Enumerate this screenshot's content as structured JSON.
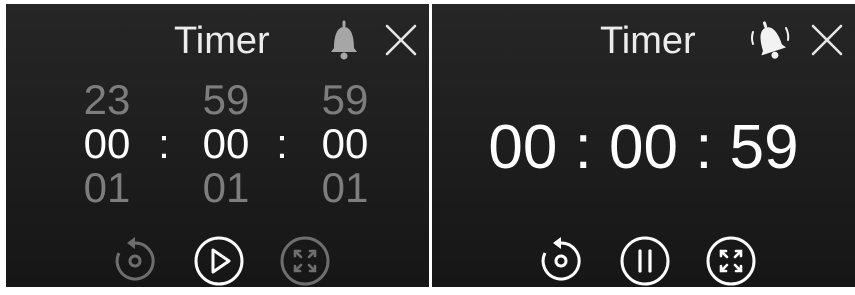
{
  "left_panel": {
    "title": "Timer",
    "picker": {
      "hours": {
        "prev": "23",
        "current": "00",
        "next": "01"
      },
      "minutes": {
        "prev": "59",
        "current": "00",
        "next": "01"
      },
      "seconds": {
        "prev": "59",
        "current": "00",
        "next": "01"
      },
      "separator": ":"
    },
    "controls": [
      "reset-icon",
      "play-icon",
      "fullscreen-icon"
    ],
    "reset_enabled": false,
    "fullscreen_enabled": false
  },
  "right_panel": {
    "title": "Timer",
    "countdown": "00 : 00 : 59",
    "alarm_ringing": true,
    "controls": [
      "reset-icon",
      "pause-icon",
      "fullscreen-icon"
    ]
  },
  "colors": {
    "background": "#1d1d1d",
    "text": "#ffffff",
    "dim_text": "#7d7d7d",
    "icon_disabled": "#6e6e6e"
  }
}
